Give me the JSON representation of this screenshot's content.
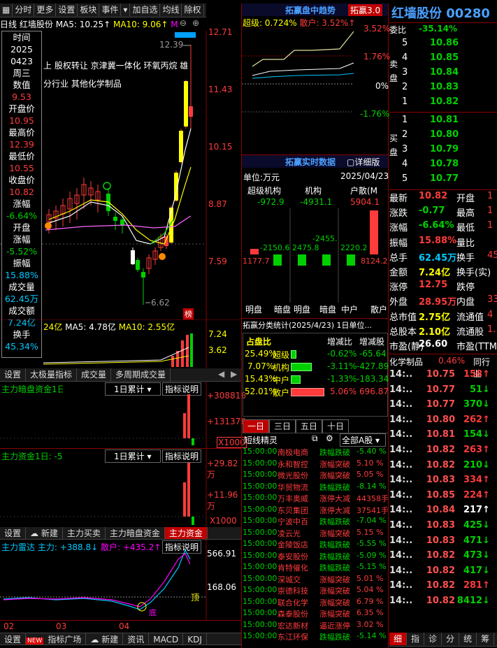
{
  "toolbar": {
    "items": [
      "分时",
      "更多",
      "设置",
      "板块",
      "事件",
      "▾",
      "加自选",
      "均线",
      "除权"
    ]
  },
  "chart_header": {
    "period": "日线",
    "stock": "红墙股份",
    "ma5": "MA5: 10.25↑",
    "ma10": "MA10: 9.06↑",
    "m_label": "M"
  },
  "price_axis": [
    "12.71",
    "11.43",
    "10.15",
    "8.87",
    "7.59"
  ],
  "info_box": {
    "time_label": "时间",
    "year": "2025",
    "date": "0423",
    "weekday": "周三",
    "value_label": "数值",
    "value": "9.53",
    "open_label": "开盘价",
    "open": "10.95",
    "high_label": "最高价",
    "high": "12.39",
    "low_label": "最低价",
    "low": "10.55",
    "close_label": "收盘价",
    "close": "10.82",
    "chg_label": "涨幅",
    "chg": "-6.64%",
    "gap_label1": "开盘",
    "gap_label2": "涨幅",
    "gap": "-5.52%",
    "amp_label": "振幅",
    "amp": "15.88%",
    "vol_label": "成交量",
    "vol": "62.45万",
    "amt_label": "成交额",
    "amt": "7.24亿",
    "turn_label": "换手",
    "turn": "45.34%"
  },
  "concepts": {
    "line1": "上 股权转让 京津冀一体化 环氧丙烷 雄",
    "line2": "分行业 其他化学制品"
  },
  "chart_marks": {
    "high_mark": "12.39",
    "low_mark": "6.62",
    "tag": "榜"
  },
  "volume_panel": {
    "amount": "24亿",
    "ma5": "MA5: 4.78亿",
    "ma10": "MA10: 2.55亿",
    "axis": [
      "7.24",
      "3.62"
    ]
  },
  "sub_tabs": [
    "设置",
    "太极量指标",
    "成交量",
    "多周期成交量"
  ],
  "dark_panel": {
    "title": "主力暗盘资金1日",
    "dropdown": "1日累计",
    "explain": "指标说明",
    "axis": [
      "+308816",
      "+131378"
    ],
    "unit": "X1000"
  },
  "fund_panel": {
    "title": "主力资金1日: -5",
    "dropdown": "1日累计",
    "explain": "指标说明",
    "axis": [
      "+29.82万",
      "+11.96万"
    ],
    "unit": "X1000"
  },
  "radar_tabs": [
    "设置",
    "新建",
    "主力买卖",
    "主力暗盘资金",
    "主力资金"
  ],
  "radar_panel": {
    "title": "主力雷达",
    "main": "主力: +388.8↓",
    "retail": "散户: +435.2↑",
    "explain": "指标说明",
    "axis": [
      "566.91",
      "168.06"
    ],
    "top_label": "顶",
    "bottom_label": "底"
  },
  "x_axis": [
    "02",
    "03",
    "04"
  ],
  "bottom_bar": [
    "设置",
    "NEW",
    "指标广场",
    "新建",
    "资讯",
    "MACD",
    "KDJ"
  ],
  "trend": {
    "title": "拓赢盘中趋势",
    "badge": "拓赢3.0",
    "super": "超级: 0.724%",
    "retail": "散户: 3.52%↑",
    "axis": [
      "3.52%",
      "1.76%",
      "0%",
      "-1.76%"
    ]
  },
  "realtime": {
    "title": "拓赢实时数据",
    "detail": "详细版",
    "unit": "单位:万元",
    "date": "2025/04/23",
    "cols": [
      "超级机构",
      "机构",
      "户散(M"
    ],
    "vals": [
      "-972.9",
      "-4931.1",
      "5904.1"
    ],
    "inner": [
      "-2150.6",
      "-2455.",
      "2475.8",
      "2220.2"
    ],
    "left_val": "1177.7",
    "right_val": "8124.2",
    "footer": [
      "明盘",
      "暗盘",
      "明盘",
      "暗盘",
      "中户",
      "散户"
    ]
  },
  "classify": {
    "title": "拓赢分类统计(2025/4/23) 1日单位...",
    "h1": "占盘比",
    "h2": "增减比",
    "h3": "增减股",
    "rows": [
      {
        "pct": "25.49%",
        "name": "超级",
        "ratio": "-0.62%",
        "shares": "-65.64"
      },
      {
        "pct": "7.07%",
        "name": "机构",
        "ratio": "-3.11%",
        "shares": "-427.89"
      },
      {
        "pct": "15.43%",
        "name": "中户",
        "ratio": "-1.33%",
        "shares": "-183.34"
      },
      {
        "pct": "52.01%",
        "name": "散户",
        "ratio": "5.06%",
        "shares": "696.87"
      }
    ]
  },
  "period_tabs": [
    "一日",
    "三日",
    "五日",
    "十日"
  ],
  "news": {
    "title": "短线精灵",
    "filter": "全部A股",
    "rows": [
      [
        "15:00:00",
        "南极电商",
        "跌幅跌破",
        "-5.40 %"
      ],
      [
        "15:00:00",
        "永和智控",
        "涨幅突破",
        "5.10 %"
      ],
      [
        "15:00:00",
        "微光股份",
        "涨幅突破",
        "5.05 %"
      ],
      [
        "15:00:00",
        "华贸物流",
        "跌幅跌破",
        "-8.14 %"
      ],
      [
        "15:00:00",
        "万丰奥威",
        "涨停大减",
        "44358手"
      ],
      [
        "15:00:00",
        "东贝集团",
        "涨停大减",
        "37541手"
      ],
      [
        "15:00:00",
        "宁波中百",
        "跌幅跌破",
        "-7.04 %"
      ],
      [
        "15:00:00",
        "凌云光",
        "涨幅突破",
        "5.15 %"
      ],
      [
        "15:00:00",
        "金陵饭店",
        "跌幅跌破",
        "-5.55 %"
      ],
      [
        "15:00:00",
        "泰安股份",
        "跌幅跌破",
        "-5.09 %"
      ],
      [
        "15:00:00",
        "肯特催化",
        "跌幅跌破",
        "-5.15 %"
      ],
      [
        "15:00:00",
        "深城交",
        "涨幅突破",
        "5.01 %"
      ],
      [
        "15:00:00",
        "崇德科技",
        "涨幅突破",
        "5.04 %"
      ],
      [
        "15:00:00",
        "联合化学",
        "涨幅突破",
        "6.79 %"
      ],
      [
        "15:00:00",
        "森泰股份",
        "涨幅突破",
        "6.35 %"
      ],
      [
        "15:00:00",
        "宏达新材",
        "逼近涨停",
        "3.02 %"
      ],
      [
        "15:00:00",
        "东江环保",
        "跌幅跌破",
        "-5.14 %"
      ]
    ]
  },
  "quote": {
    "name": "红墙股份",
    "code": "00280",
    "wb_label": "委比",
    "wb": "-35.14%",
    "sell_label": "卖盘",
    "buy_label": "买盘",
    "sell": [
      [
        "5",
        "10.86"
      ],
      [
        "4",
        "10.85"
      ],
      [
        "3",
        "10.84"
      ],
      [
        "2",
        "10.83"
      ],
      [
        "1",
        "10.82"
      ]
    ],
    "buy": [
      [
        "1",
        "10.81"
      ],
      [
        "2",
        "10.80"
      ],
      [
        "3",
        "10.79"
      ],
      [
        "4",
        "10.78"
      ],
      [
        "5",
        "10.77"
      ]
    ],
    "stats": [
      [
        "最新",
        "10.82",
        "开盘",
        "1"
      ],
      [
        "涨跌",
        "-0.77",
        "最高",
        "1"
      ],
      [
        "涨幅",
        "-6.64%",
        "最低",
        "1"
      ],
      [
        "振幅",
        "15.88%",
        "量比",
        ""
      ],
      [
        "总手",
        "62.45万",
        "换手",
        "45"
      ],
      [
        "金额",
        "7.24亿",
        "换手(实)",
        ""
      ],
      [
        "涨停",
        "12.75",
        "跌停",
        ""
      ],
      [
        "外盘",
        "28.95万",
        "内盘",
        "33"
      ],
      [
        "总市值",
        "2.75亿",
        "流通值",
        "4"
      ],
      [
        "总股本",
        "2.10亿",
        "流通股",
        "1."
      ],
      [
        "市盈(静)",
        "26.60",
        "市盈(TTM)",
        ""
      ]
    ],
    "sector": "化学制品",
    "sector_pct": "0.46%",
    "peer": "同行业"
  },
  "ticks": [
    [
      "14:..",
      "10.75",
      "158",
      "up"
    ],
    [
      "14:..",
      "10.77",
      "51",
      "dn"
    ],
    [
      "14:..",
      "10.77",
      "370",
      "dn"
    ],
    [
      "14:..",
      "10.80",
      "262",
      "up"
    ],
    [
      "14:..",
      "10.81",
      "154",
      "dn"
    ],
    [
      "14:..",
      "10.82",
      "263",
      "up"
    ],
    [
      "14:..",
      "10.82",
      "210",
      "dn"
    ],
    [
      "14:..",
      "10.83",
      "334",
      "up"
    ],
    [
      "14:..",
      "10.85",
      "224",
      "up"
    ],
    [
      "14:..",
      "10.84",
      "217",
      "w"
    ],
    [
      "14:..",
      "10.83",
      "425",
      "dn"
    ],
    [
      "14:..",
      "10.83",
      "471",
      "dn"
    ],
    [
      "14:..",
      "10.82",
      "473",
      "dn"
    ],
    [
      "14:..",
      "10.82",
      "417",
      "dn"
    ],
    [
      "14:..",
      "10.82",
      "281",
      "up"
    ],
    [
      "14:..",
      "10.82",
      "8412",
      "dn"
    ]
  ],
  "right_bottom_tabs": [
    "细",
    "指",
    "诊",
    "分",
    "统",
    "筹"
  ],
  "colors": {
    "up": "#ff3b3b",
    "down": "#00d000",
    "ma5": "#ffffff",
    "ma10": "#ffff00",
    "ma20": "#ff00ff",
    "bg": "#000000"
  }
}
